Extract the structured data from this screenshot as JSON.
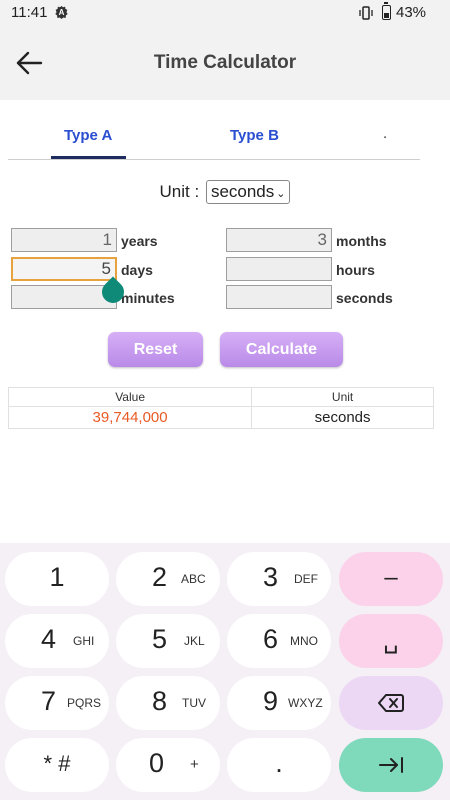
{
  "status": {
    "time": "11:41",
    "battery": "43%"
  },
  "header": {
    "title": "Time Calculator"
  },
  "tabs": [
    {
      "label": "Type A"
    },
    {
      "label": "Type B"
    },
    {
      "label": "."
    }
  ],
  "unit": {
    "label": "Unit :",
    "selected": "seconds"
  },
  "fields": {
    "years": {
      "value": "1",
      "label": "years"
    },
    "months": {
      "value": "3",
      "label": "months"
    },
    "days": {
      "value": "5",
      "label": "days"
    },
    "hours": {
      "value": "",
      "label": "hours"
    },
    "minutes": {
      "value": "",
      "label": "minutes"
    },
    "seconds": {
      "value": "",
      "label": "seconds"
    }
  },
  "buttons": {
    "reset": "Reset",
    "calculate": "Calculate"
  },
  "results": {
    "headers": [
      "Value",
      "Unit"
    ],
    "value": "39,744,000",
    "unit": "seconds"
  },
  "keyboard": {
    "k1": {
      "num": "1",
      "letters": ""
    },
    "k2": {
      "num": "2",
      "letters": "ABC"
    },
    "k3": {
      "num": "3",
      "letters": "DEF"
    },
    "k4": {
      "num": "4",
      "letters": "GHI"
    },
    "k5": {
      "num": "5",
      "letters": "JKL"
    },
    "k6": {
      "num": "6",
      "letters": "MNO"
    },
    "k7": {
      "num": "7",
      "letters": "PQRS"
    },
    "k8": {
      "num": "8",
      "letters": "TUV"
    },
    "k9": {
      "num": "9",
      "letters": "WXYZ"
    },
    "kstar": {
      "num": "* #"
    },
    "k0": {
      "num": "0",
      "letters": "+"
    },
    "kdot": {
      "num": "."
    },
    "minus": "–",
    "space": "␣",
    "accent_minus": "#fbd2ea",
    "accent_go": "#7fd9bb"
  },
  "colors": {
    "tab_text": "#2a4fd0",
    "result_value": "#e85a24",
    "button": "#c79bef",
    "focus_border": "#e8a23d"
  }
}
